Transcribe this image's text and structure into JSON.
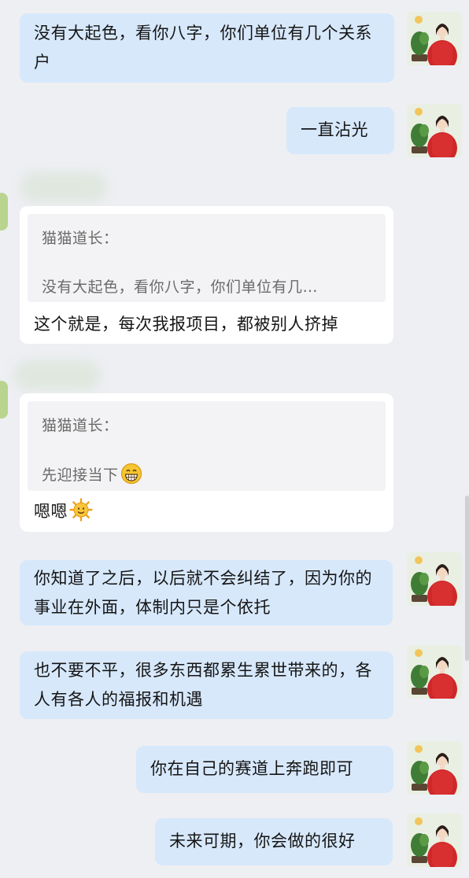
{
  "messages": [
    {
      "side": "right",
      "text": "没有大起色，看你八字，你们单位有几个关系户"
    },
    {
      "side": "right",
      "text": "一直沾光"
    },
    {
      "side": "left",
      "quote_name": "猫猫道长：",
      "quote_text": "没有大起色，看你八字，你们单位有几…",
      "text": "这个就是，每次我报项目，都被别人挤掉"
    },
    {
      "side": "left",
      "quote_name": "猫猫道长：",
      "quote_text": "先迎接当下",
      "quote_emoji": "grinning-face-emoji",
      "text": "嗯嗯",
      "text_emoji": "sun-face-emoji"
    },
    {
      "side": "right",
      "text": "你知道了之后，以后就不会纠结了，因为你的事业在外面，体制内只是个依托"
    },
    {
      "side": "right",
      "text": "也不要不平，很多东西都累生累世带来的，各人有各人的福报和机遇"
    },
    {
      "side": "right",
      "text": "你在自己的赛道上奔跑即可"
    },
    {
      "side": "right",
      "text": "未来可期，你会做的很好"
    }
  ],
  "colors": {
    "background": "#eeeff3",
    "sent_bubble": "#d7e8fb",
    "received_bubble": "#ffffff",
    "quote_box": "#f3f3f5"
  }
}
